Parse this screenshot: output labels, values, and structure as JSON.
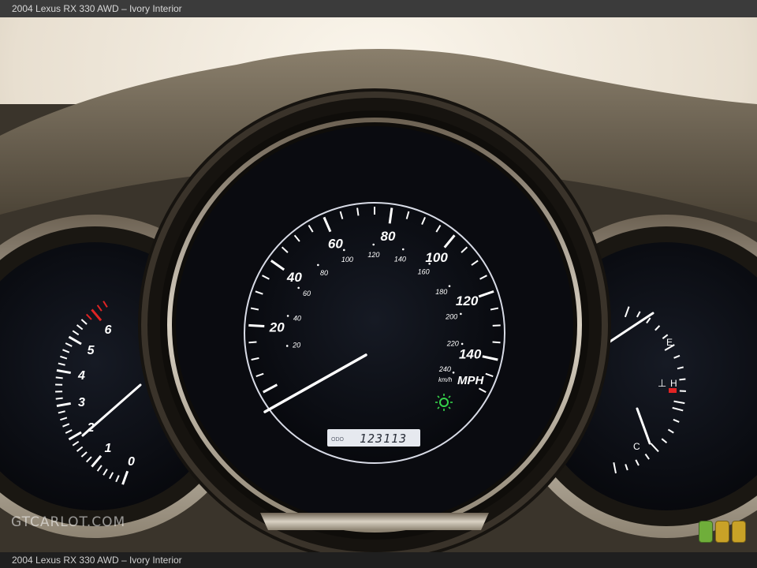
{
  "header": {
    "title": "2004 Lexus RX 330 AWD – Ivory Interior"
  },
  "footer": {
    "caption": "2004 Lexus RX 330 AWD – Ivory Interior"
  },
  "watermark": {
    "text": "GTCARLOT.COM"
  },
  "speedometer": {
    "mph_labels": [
      "20",
      "40",
      "60",
      "80",
      "100",
      "120",
      "140"
    ],
    "kmh_labels": [
      "20",
      "40",
      "60",
      "80",
      "100",
      "120",
      "140",
      "160",
      "180",
      "200",
      "220",
      "240"
    ],
    "unit_mph": "MPH",
    "unit_kmh": "km/h",
    "odometer_label": "ODO",
    "odometer_value": "123113"
  },
  "tachometer": {
    "labels": [
      "0",
      "1",
      "2",
      "3",
      "4",
      "5",
      "6"
    ]
  },
  "fuel_gauge": {
    "empty_label": "E"
  },
  "temp_gauge": {
    "hot_label": "H",
    "cold_label": "C"
  },
  "colors": {
    "dash_trim": "#6e6351",
    "gauge_face": "#0b0d14",
    "marking": "#ffffff",
    "redline": "#e02424",
    "indicator_green": "#35d24a",
    "rating": [
      "#6fae3a",
      "#c9a227",
      "#c9a227"
    ]
  }
}
